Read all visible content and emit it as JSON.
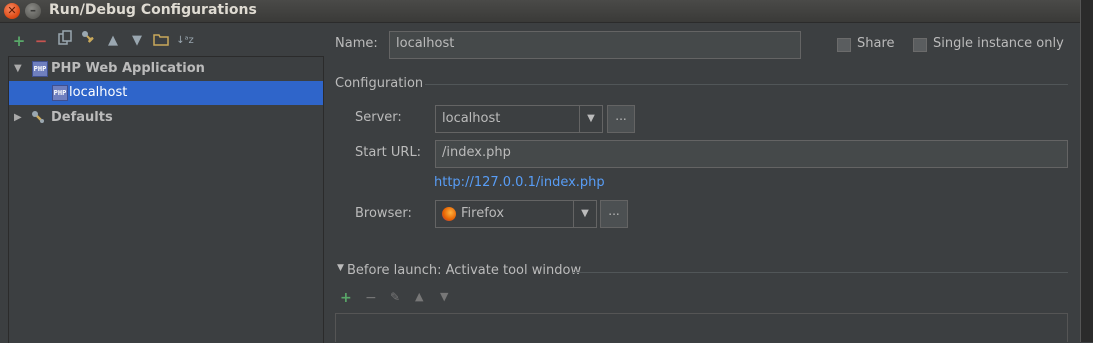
{
  "window": {
    "title": "Run/Debug Configurations"
  },
  "tree": {
    "group_label": "PHP Web Application",
    "selected_item": "localhost",
    "defaults_label": "Defaults",
    "php_icon_text": "PHP"
  },
  "form": {
    "name_label": "Name:",
    "name_value": "localhost",
    "share_label": "Share",
    "single_instance_label": "Single instance only",
    "configuration_header": "Configuration",
    "server_label": "Server:",
    "server_value": "localhost",
    "start_url_label": "Start URL:",
    "start_url_value": "/index.php",
    "resolved_url": "http://127.0.0.1/index.php",
    "browser_label": "Browser:",
    "browser_value": "Firefox",
    "dots": "...",
    "before_launch_label": "Before launch: Activate tool window"
  },
  "colors": {
    "background": "#3c3f41",
    "selection": "#2f65ca",
    "link": "#589df6",
    "add_green": "#59a869",
    "remove_red": "#c75450"
  }
}
